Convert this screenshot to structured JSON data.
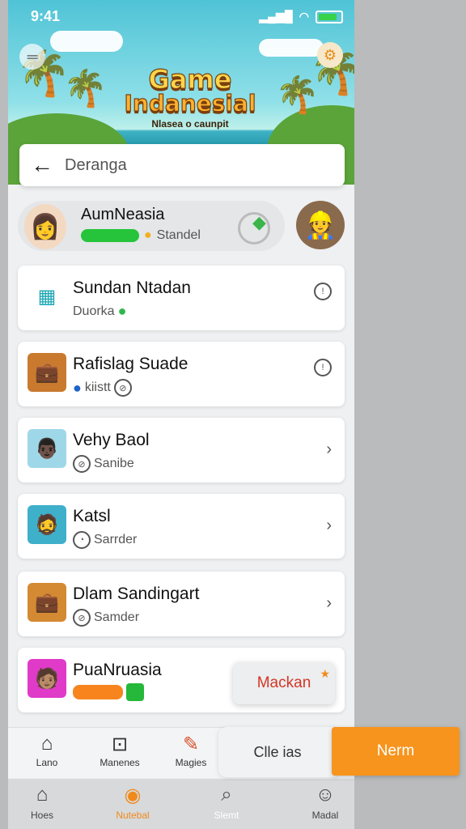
{
  "status": {
    "time": "9:41"
  },
  "hero": {
    "title_line1": "Game",
    "title_line2": "Indanesial",
    "subtitle": "Nlasea o caunpit"
  },
  "search": {
    "query": "Deranga"
  },
  "user": {
    "name": "AumNeasia",
    "status": "Standel"
  },
  "items": [
    {
      "title": "Sundan Ntadan",
      "sub": "Duorka"
    },
    {
      "title": "Rafislag Suade",
      "sub": "kiistt"
    },
    {
      "title": "Vehy Baol",
      "sub": "Sanibe"
    },
    {
      "title": "Katsl",
      "sub": "Sarrder"
    },
    {
      "title": "Dlam Sandingart",
      "sub": "Samder"
    },
    {
      "title": "PuaNruasia",
      "sub": ""
    }
  ],
  "tooltip": {
    "label": "Mackan"
  },
  "mid_nav": [
    {
      "label": "Lano",
      "icon": "home-icon"
    },
    {
      "label": "Manenes",
      "icon": "robot-icon"
    },
    {
      "label": "Magies",
      "icon": "map-icon"
    }
  ],
  "secondary_button": {
    "label": "Clle ias"
  },
  "primary_button": {
    "label": "Nerm"
  },
  "bottom_nav": [
    {
      "label": "Hoes",
      "icon": "home-icon"
    },
    {
      "label": "Nutebal",
      "icon": "ball-icon",
      "active": true
    },
    {
      "label": "Slemt",
      "icon": "search-icon"
    },
    {
      "label": "Madal",
      "icon": "profile-icon"
    }
  ],
  "colors": {
    "accent": "#f7941d",
    "green": "#25c43a",
    "tooltip_text": "#d63526"
  }
}
